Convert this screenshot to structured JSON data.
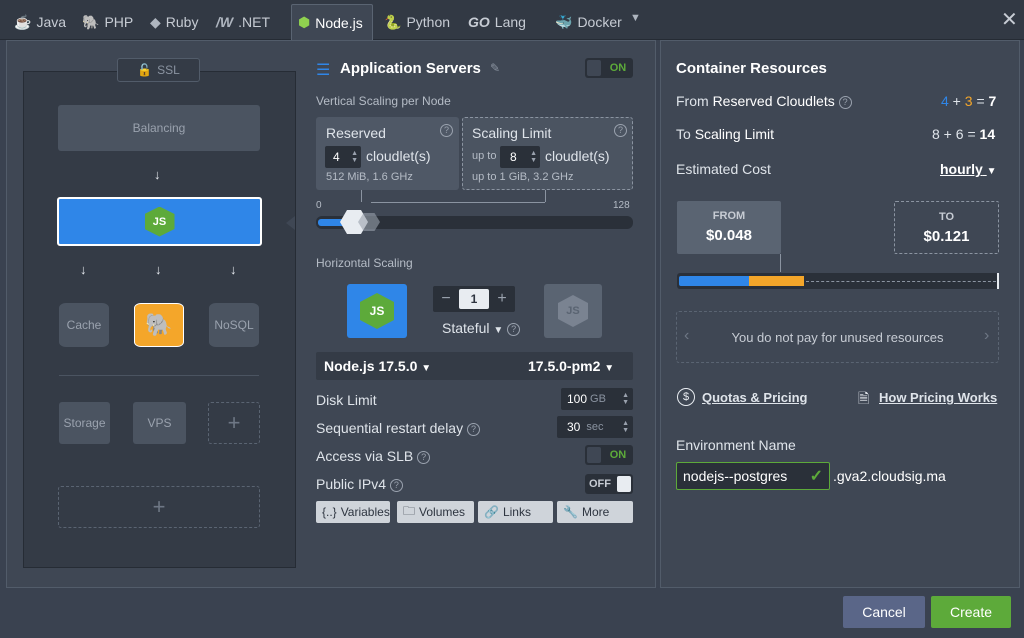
{
  "tabs": [
    {
      "label": "Java",
      "icon": "java-icon"
    },
    {
      "label": "PHP",
      "icon": "php-icon"
    },
    {
      "label": "Ruby",
      "icon": "ruby-icon"
    },
    {
      "label": ".NET",
      "icon": "dotnet-icon"
    },
    {
      "label": "Node.js",
      "icon": "nodejs-icon",
      "active": true
    },
    {
      "label": "Python",
      "icon": "python-icon"
    },
    {
      "label": "Lang",
      "icon": "go-icon",
      "prefix": "GO"
    },
    {
      "label": "Docker",
      "icon": "docker-icon"
    }
  ],
  "topology": {
    "ssl_label": "SSL",
    "balancing_label": "Balancing",
    "cache_label": "Cache",
    "nosql_label": "NoSQL",
    "storage_label": "Storage",
    "vps_label": "VPS"
  },
  "app_servers": {
    "title": "Application Servers",
    "toggle": "ON",
    "vertical_label": "Vertical Scaling per Node",
    "reserved": {
      "label": "Reserved",
      "value": "4",
      "unit": "cloudlet(s)",
      "info": "512 MiB, 1.6 GHz"
    },
    "scaling_limit": {
      "label": "Scaling Limit",
      "prefix": "up to",
      "value": "8",
      "unit": "cloudlet(s)",
      "info_prefix": "up to",
      "info": "1 GiB, 3.2 GHz"
    },
    "slider_min": "0",
    "slider_max": "128",
    "horizontal_label": "Horizontal Scaling",
    "node_count": "1",
    "stateful_label": "Stateful",
    "engine": "Node.js 17.5.0",
    "version": "17.5.0-pm2",
    "disk_limit_label": "Disk Limit",
    "disk_limit_value": "100",
    "disk_limit_unit": "GB",
    "restart_delay_label": "Sequential restart delay",
    "restart_delay_value": "30",
    "restart_delay_unit": "sec",
    "slb_label": "Access via SLB",
    "slb_toggle": "ON",
    "ipv4_label": "Public IPv4",
    "ipv4_toggle": "OFF",
    "buttons": {
      "variables": "Variables",
      "volumes": "Volumes",
      "links": "Links",
      "more": "More"
    }
  },
  "resources": {
    "title": "Container Resources",
    "from_prefix": "From",
    "from_label": "Reserved Cloudlets",
    "from_a": "4",
    "from_b": "3",
    "from_total": "7",
    "to_prefix": "To",
    "to_label": "Scaling Limit",
    "to_a": "8",
    "to_b": "6",
    "to_total": "14",
    "cost_label": "Estimated Cost",
    "cost_period": "hourly",
    "from_price_label": "FROM",
    "from_price": "$0.048",
    "to_price_label": "TO",
    "to_price": "$0.121",
    "usage_bar": {
      "blue_fraction": 0.22,
      "orange_fraction": 0.18
    },
    "note": "You do not pay for unused resources",
    "quotas_link": "Quotas & Pricing",
    "pricing_link": "How Pricing Works",
    "env_label": "Environment Name",
    "env_value": "nodejs--postgres",
    "env_domain": ".gva2.cloudsig.ma"
  },
  "footer": {
    "cancel": "Cancel",
    "create": "Create"
  },
  "colors": {
    "accent_blue": "#2f86e8",
    "green": "#5daa3a",
    "orange": "#f4a62a",
    "bg": "#3a4250"
  }
}
